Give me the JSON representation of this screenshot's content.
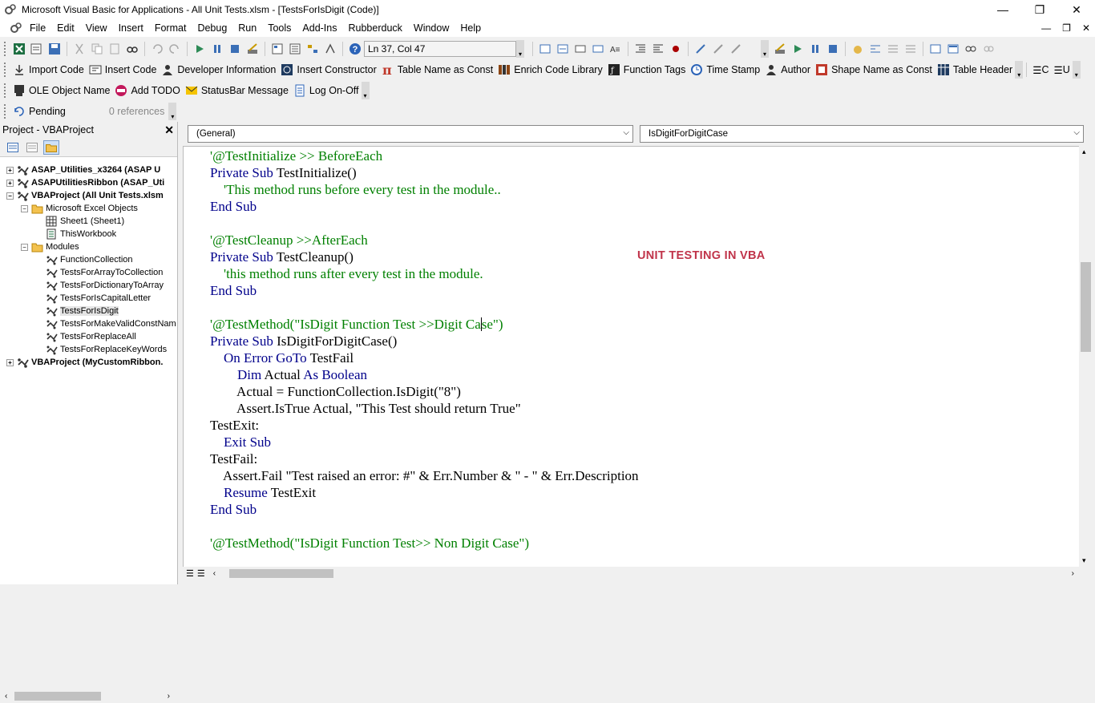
{
  "window": {
    "title": "Microsoft Visual Basic for Applications - All Unit Tests.xlsm - [TestsForIsDigit (Code)]",
    "minimize": "—",
    "restore": "❐",
    "close": "✕"
  },
  "menu": {
    "items": [
      "File",
      "Edit",
      "View",
      "Insert",
      "Format",
      "Debug",
      "Run",
      "Tools",
      "Add-Ins",
      "Rubberduck",
      "Window",
      "Help"
    ],
    "mdi_minimize": "—",
    "mdi_restore": "❐",
    "mdi_close": "✕"
  },
  "standard_toolbar": {
    "cursor_position": "Ln 37, Col 47"
  },
  "custom_toolbar_1": {
    "buttons": [
      "Import Code",
      "Insert Code",
      "Developer Information",
      "Insert Constructor",
      "Table Name as Const",
      "Enrich Code Library",
      "Function Tags",
      "Time Stamp",
      "Author",
      "Shape Name as Const",
      "Table Header"
    ],
    "trailing_c": "C",
    "trailing_u": "U"
  },
  "custom_toolbar_2": {
    "buttons": [
      "OLE Object Name",
      "Add TODO",
      "StatusBar Message",
      "Log On-Off"
    ]
  },
  "rubberduck_bar": {
    "status": "Pending",
    "references": "0 references"
  },
  "project_explorer": {
    "title": "Project - VBAProject",
    "close": "✕",
    "tree": [
      {
        "label": "ASAP_Utilities_x3264 (ASAP U",
        "level": 0,
        "bold": true,
        "exp": "+"
      },
      {
        "label": "ASAPUtilitiesRibbon (ASAP_Uti",
        "level": 0,
        "bold": true,
        "exp": "+"
      },
      {
        "label": "VBAProject (All Unit Tests.xlsm",
        "level": 0,
        "bold": true,
        "exp": "−"
      },
      {
        "label": "Microsoft Excel Objects",
        "level": 1,
        "bold": false,
        "exp": "−",
        "icon": "folder"
      },
      {
        "label": "Sheet1 (Sheet1)",
        "level": 2,
        "bold": false,
        "icon": "sheet"
      },
      {
        "label": "ThisWorkbook",
        "level": 2,
        "bold": false,
        "icon": "workbook"
      },
      {
        "label": "Modules",
        "level": 1,
        "bold": false,
        "exp": "−",
        "icon": "folder"
      },
      {
        "label": "FunctionCollection",
        "level": 2,
        "bold": false,
        "icon": "module"
      },
      {
        "label": "TestsForArrayToCollection",
        "level": 2,
        "bold": false,
        "icon": "module"
      },
      {
        "label": "TestsForDictionaryToArray",
        "level": 2,
        "bold": false,
        "icon": "module"
      },
      {
        "label": "TestsForIsCapitalLetter",
        "level": 2,
        "bold": false,
        "icon": "module"
      },
      {
        "label": "TestsForIsDigit",
        "level": 2,
        "bold": false,
        "icon": "module",
        "selected": true
      },
      {
        "label": "TestsForMakeValidConstNam",
        "level": 2,
        "bold": false,
        "icon": "module"
      },
      {
        "label": "TestsForReplaceAll",
        "level": 2,
        "bold": false,
        "icon": "module"
      },
      {
        "label": "TestsForReplaceKeyWords",
        "level": 2,
        "bold": false,
        "icon": "module"
      },
      {
        "label": "VBAProject (MyCustomRibbon.",
        "level": 0,
        "bold": true,
        "exp": "+"
      }
    ]
  },
  "code_window": {
    "object_combo": "(General)",
    "procedure_combo": "IsDigitForDigitCase",
    "overlay_title": "UNIT TESTING IN VBA",
    "lines": [
      [
        {
          "t": "cm",
          "s": "'@TestInitialize >> BeforeEach"
        }
      ],
      [
        {
          "t": "kw",
          "s": "Private Sub "
        },
        {
          "t": "tx",
          "s": "TestInitialize()"
        }
      ],
      [
        {
          "t": "cm",
          "s": "    'This method runs before every test in the module.."
        }
      ],
      [
        {
          "t": "kw",
          "s": "End Sub"
        }
      ],
      [],
      [
        {
          "t": "cm",
          "s": "'@TestCleanup >>AfterEach"
        }
      ],
      [
        {
          "t": "kw",
          "s": "Private Sub "
        },
        {
          "t": "tx",
          "s": "TestCleanup()"
        }
      ],
      [
        {
          "t": "cm",
          "s": "    'this method runs after every test in the module."
        }
      ],
      [
        {
          "t": "kw",
          "s": "End Sub"
        }
      ],
      [],
      [
        {
          "t": "cm",
          "s": "'@TestMethod(\"IsDigit Function Test >>Digit Ca"
        },
        {
          "t": "caret",
          "s": ""
        },
        {
          "t": "cm",
          "s": "se\")"
        }
      ],
      [
        {
          "t": "kw",
          "s": "Private Sub "
        },
        {
          "t": "tx",
          "s": "IsDigitForDigitCase()"
        }
      ],
      [
        {
          "t": "kw",
          "s": "    On Error GoTo "
        },
        {
          "t": "tx",
          "s": "TestFail"
        }
      ],
      [
        {
          "t": "kw",
          "s": "        Dim "
        },
        {
          "t": "tx",
          "s": "Actual "
        },
        {
          "t": "kw",
          "s": "As Boolean"
        }
      ],
      [
        {
          "t": "tx",
          "s": "        Actual = FunctionCollection.IsDigit(\"8\")"
        }
      ],
      [
        {
          "t": "tx",
          "s": "        Assert.IsTrue Actual, \"This Test should return True\""
        }
      ],
      [
        {
          "t": "tx",
          "s": "TestExit:"
        }
      ],
      [
        {
          "t": "kw",
          "s": "    Exit Sub"
        }
      ],
      [
        {
          "t": "tx",
          "s": "TestFail:"
        }
      ],
      [
        {
          "t": "tx",
          "s": "    Assert.Fail \"Test raised an error: #\" & Err.Number & \" - \" & Err.Description"
        }
      ],
      [
        {
          "t": "kw",
          "s": "    Resume "
        },
        {
          "t": "tx",
          "s": "TestExit"
        }
      ],
      [
        {
          "t": "kw",
          "s": "End Sub"
        }
      ],
      [],
      [
        {
          "t": "cm",
          "s": "'@TestMethod(\"IsDigit Function Test>> Non Digit Case\")"
        }
      ]
    ]
  }
}
